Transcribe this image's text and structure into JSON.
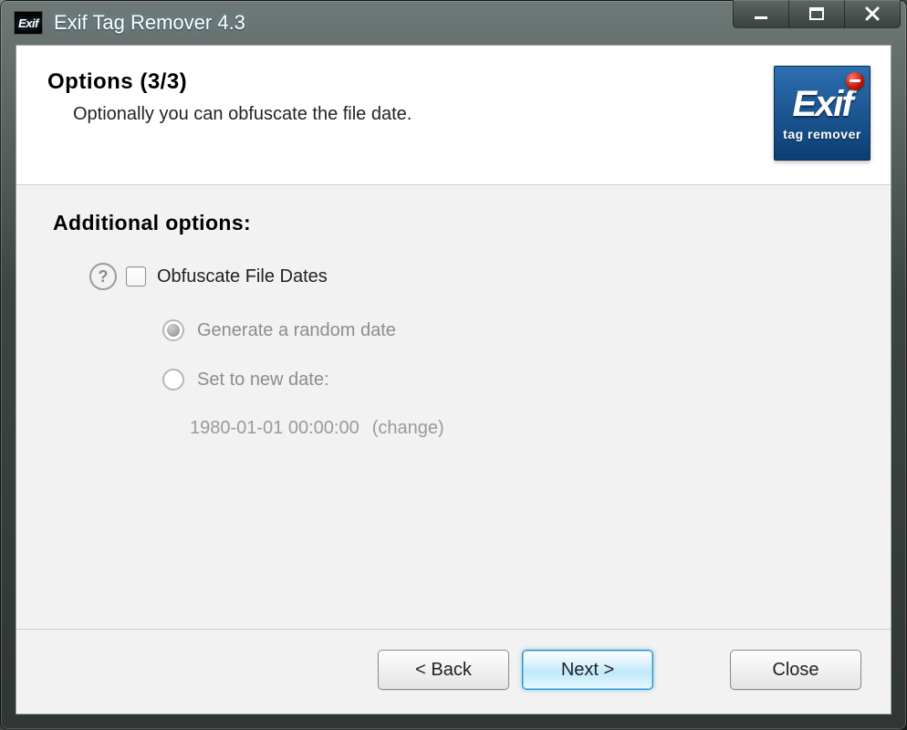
{
  "window": {
    "title": "Exif Tag Remover 4.3",
    "app_icon_text": "Exif"
  },
  "header": {
    "title": "Options (3/3)",
    "subtitle": "Optionally you can obfuscate the file date."
  },
  "logo": {
    "big": "Exif",
    "small": "tag remover"
  },
  "section_title": "Additional options:",
  "obfuscate": {
    "label": "Obfuscate File Dates",
    "random_label": "Generate a random date",
    "set_label": "Set to new date:",
    "date_value": "1980-01-01 00:00:00",
    "change_label": "(change)"
  },
  "buttons": {
    "back": "< Back",
    "next": "Next >",
    "close": "Close"
  }
}
